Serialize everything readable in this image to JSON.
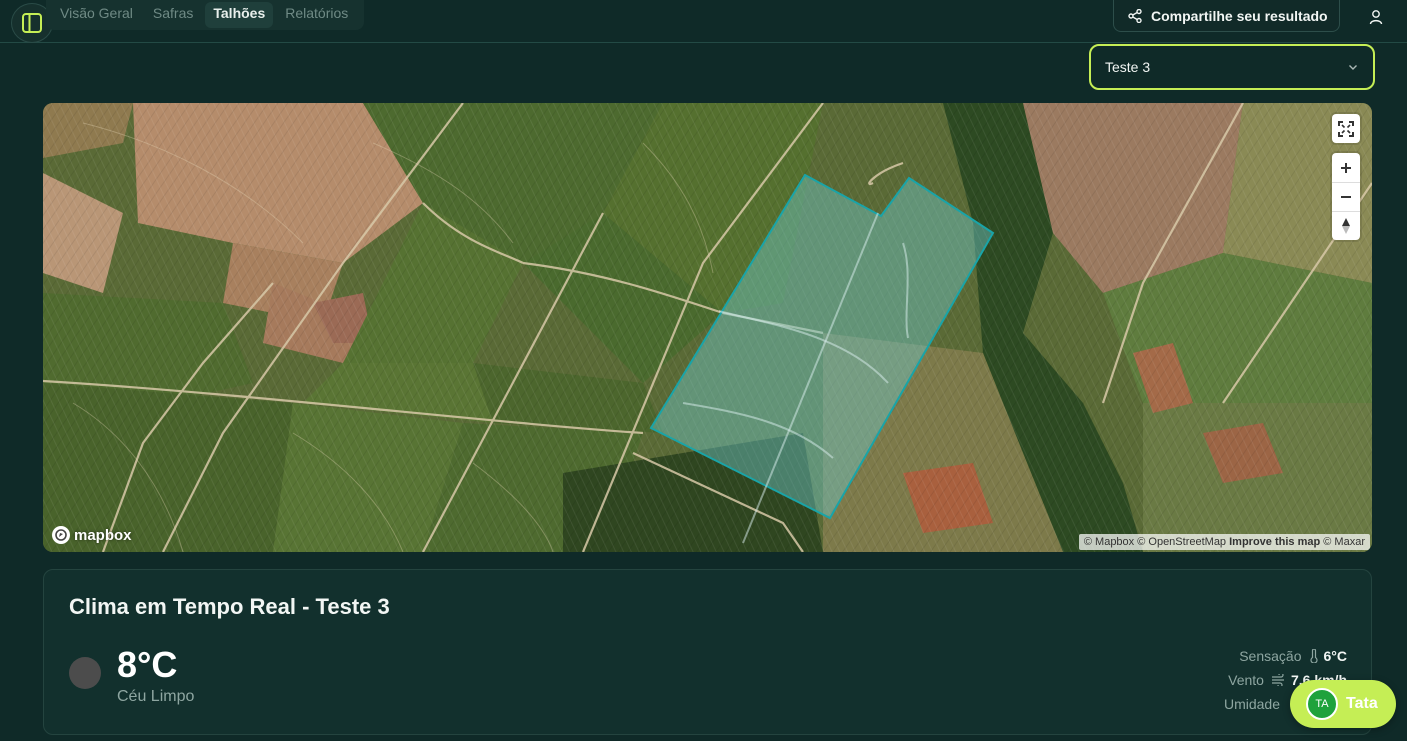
{
  "nav": {
    "tabs": [
      {
        "label": "Visão Geral",
        "active": false
      },
      {
        "label": "Safras",
        "active": false
      },
      {
        "label": "Talhões",
        "active": true
      },
      {
        "label": "Relatórios",
        "active": false
      }
    ],
    "share_label": "Compartilhe seu resultado"
  },
  "plot_select": {
    "value": "Teste 3"
  },
  "map": {
    "logo": "mapbox",
    "attribution": {
      "mapbox": "© Mapbox",
      "osm": "© OpenStreetMap",
      "improve": "Improve this map",
      "maxar": "© Maxar"
    },
    "controls": [
      "fullscreen-icon",
      "zoom-in-icon",
      "zoom-out-icon",
      "compass-icon"
    ]
  },
  "weather": {
    "title": "Clima em Tempo Real - Teste 3",
    "temperature": "8°C",
    "condition": "Céu Limpo",
    "feels_label": "Sensação",
    "feels_value": "6°C",
    "wind_label": "Vento",
    "wind_value": "7.6 km/h",
    "humidity_label": "Umidade"
  },
  "chat": {
    "avatar_initials": "TA",
    "name": "Tata"
  },
  "colors": {
    "accent": "#c5ee55",
    "background": "#0f2a28",
    "card": "#12302d",
    "polygon": "#19a4a8"
  }
}
